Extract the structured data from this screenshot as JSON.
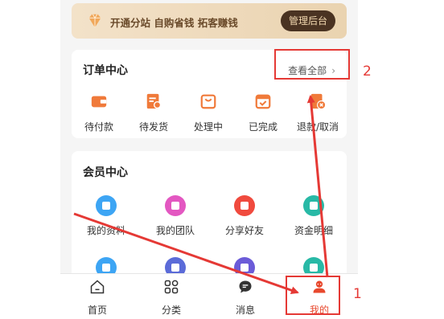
{
  "promo": {
    "text": "开通分站 自购省钱 拓客赚钱",
    "admin_label": "管理后台"
  },
  "order_center": {
    "title": "订单中心",
    "view_all": "查看全部",
    "items": [
      {
        "label": "待付款",
        "icon": "wallet-icon"
      },
      {
        "label": "待发货",
        "icon": "pending-ship-icon"
      },
      {
        "label": "处理中",
        "icon": "processing-bag-icon"
      },
      {
        "label": "已完成",
        "icon": "completed-box-icon"
      },
      {
        "label": "退款/取消",
        "icon": "refund-icon"
      }
    ]
  },
  "member_center": {
    "title": "会员中心",
    "items": [
      {
        "label": "我的资料",
        "icon": "profile-icon",
        "color": "#3da5f4"
      },
      {
        "label": "我的团队",
        "icon": "team-icon",
        "color": "#e357c1"
      },
      {
        "label": "分享好友",
        "icon": "share-icon",
        "color": "#f04a3e"
      },
      {
        "label": "资金明细",
        "icon": "funds-icon",
        "color": "#28b9a6"
      },
      {
        "label": "",
        "icon": "shield-icon",
        "color": "#3da5f4"
      },
      {
        "label": "",
        "icon": "home-icon",
        "color": "#5b6bd8"
      },
      {
        "label": "",
        "icon": "star-icon",
        "color": "#6b5bd8"
      },
      {
        "label": "",
        "icon": "bookmark-icon",
        "color": "#28b9a6"
      }
    ]
  },
  "tabbar": {
    "items": [
      {
        "label": "首页",
        "icon": "home-outline-icon"
      },
      {
        "label": "分类",
        "icon": "grid-icon"
      },
      {
        "label": "消息",
        "icon": "message-icon"
      },
      {
        "label": "我的",
        "icon": "user-icon",
        "active": true
      }
    ]
  },
  "annotations": {
    "label_1": "1",
    "label_2": "2"
  },
  "colors": {
    "accent": "#e8482d",
    "annotation": "#e53935",
    "order_icon": "#f07a3a"
  }
}
